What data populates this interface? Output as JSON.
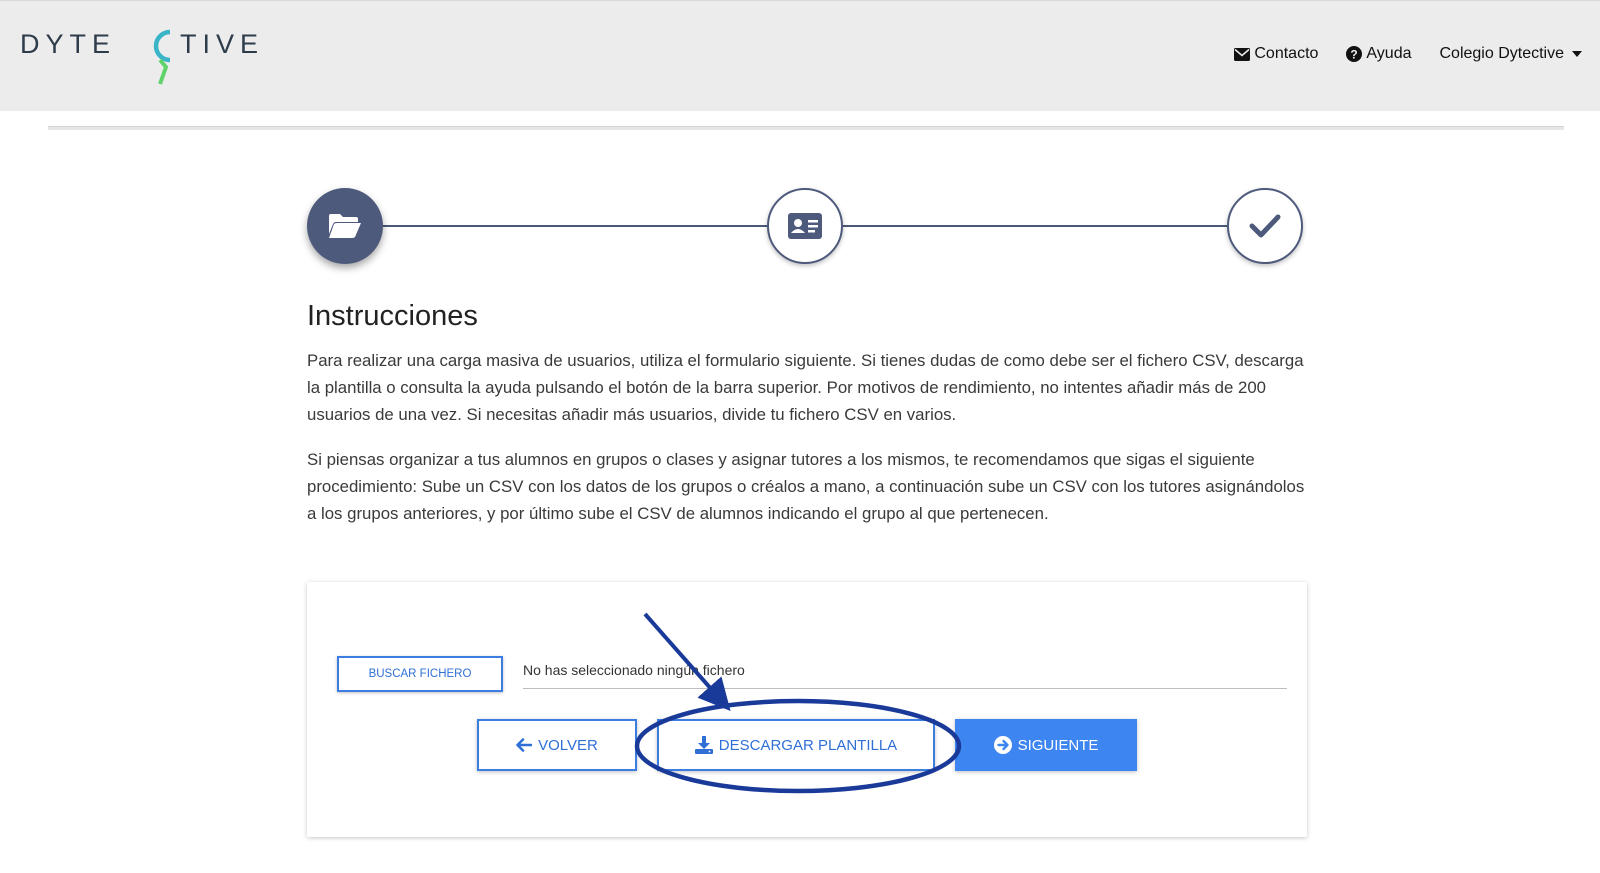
{
  "header": {
    "logo": {
      "text_left": "DYTE",
      "text_right": "TIVE",
      "brand_colors": [
        "#3ab5c8",
        "#5fd36a",
        "#2d3b4a"
      ]
    },
    "nav": {
      "contact_label": "Contacto",
      "help_label": "Ayuda",
      "account_label": "Colegio Dytective"
    }
  },
  "stepper": {
    "steps": [
      {
        "icon": "folder-open-icon",
        "state": "active"
      },
      {
        "icon": "id-card-icon",
        "state": "pending"
      },
      {
        "icon": "check-icon",
        "state": "pending"
      }
    ]
  },
  "instructions": {
    "title": "Instrucciones",
    "paragraph1": "Para realizar una carga masiva de usuarios, utiliza el formulario siguiente. Si tienes dudas de como debe ser el fichero CSV, descarga la plantilla o consulta la ayuda pulsando el botón de la barra superior. Por motivos de rendimiento, no intentes añadir más de 200 usuarios de una vez. Si necesitas añadir más usuarios, divide tu fichero CSV en varios.",
    "paragraph2": "Si piensas organizar a tus alumnos en grupos o clases y asignar tutores a los mismos, te recomendamos que sigas el siguiente procedimiento: Sube un CSV con los datos de los grupos o créalos a mano, a continuación sube un CSV con los tutores asignándolos a los grupos anteriores, y por último sube el CSV de alumnos indicando el grupo al que pertenecen."
  },
  "upload": {
    "browse_label": "BUSCAR FICHERO",
    "file_status": "No has seleccionado ningún fichero",
    "back_label": "VOLVER",
    "download_label": "DESCARGAR PLANTILLA",
    "next_label": "SIGUIENTE"
  },
  "colors": {
    "primary": "#3d85f0",
    "step_dark": "#4e5a7c",
    "annotation": "#1a3a9a",
    "header_bg": "#ececec"
  }
}
